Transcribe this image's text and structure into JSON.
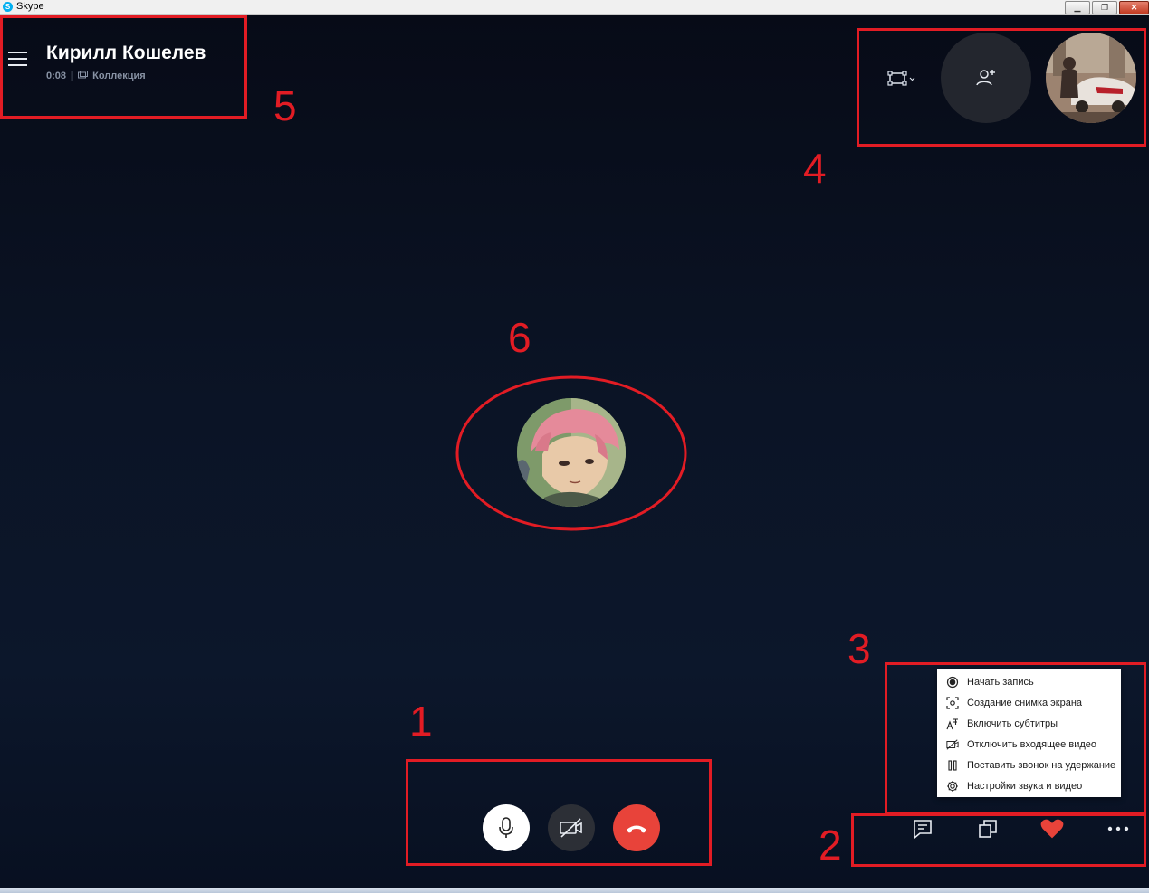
{
  "window": {
    "title": "Skype",
    "app_icon": "skype-icon",
    "buttons": {
      "minimize": "minimize-icon",
      "maximize": "restore-icon",
      "close": "close-icon"
    }
  },
  "header": {
    "caller_name": "Кирилл Кошелев",
    "call_duration": "0:08",
    "separator": "|",
    "collection_label": "Коллекция"
  },
  "top_right": {
    "layout_icon": "layout-icon",
    "add_person_icon": "add-person-icon",
    "self_preview": "self-preview-video"
  },
  "center": {
    "avatar": "peer-avatar"
  },
  "call_controls": {
    "mic_icon": "microphone-icon",
    "video_icon": "video-off-icon",
    "end_icon": "hang-up-icon",
    "colors": {
      "mic_bg": "#ffffff",
      "video_bg": "#2c2f36",
      "end_bg": "#e8433a"
    }
  },
  "bottom_right": {
    "chat_icon": "chat-icon",
    "share_icon": "share-screen-icon",
    "react_icon": "heart-icon",
    "more_icon": "more-icon"
  },
  "menu": {
    "items": [
      {
        "label": "Начать запись",
        "icon": "record-icon"
      },
      {
        "label": "Создание снимка экрана",
        "icon": "screenshot-icon"
      },
      {
        "label": "Включить субтитры",
        "icon": "subtitles-icon"
      },
      {
        "label": "Отключить входящее видео",
        "icon": "video-off-icon"
      },
      {
        "label": "Поставить звонок на удержание",
        "icon": "pause-icon"
      },
      {
        "label": "Настройки звука и видео",
        "icon": "settings-icon"
      }
    ]
  },
  "annotations": {
    "labels": [
      "1",
      "2",
      "3",
      "4",
      "5",
      "6"
    ],
    "color": "#e21c24"
  }
}
